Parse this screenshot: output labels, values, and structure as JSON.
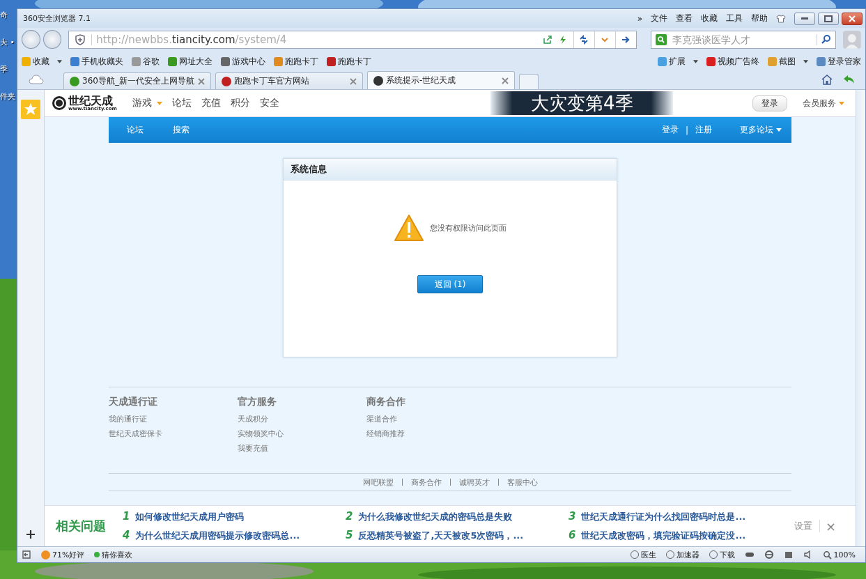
{
  "desktop": {
    "labels": [
      "奇",
      "夫 •",
      "季",
      "件夹"
    ]
  },
  "window": {
    "title": "360安全浏览器 7.1",
    "menu": [
      "»",
      "文件",
      "查看",
      "收藏",
      "工具",
      "帮助"
    ]
  },
  "address_bar": {
    "url_prefix": "http://newbbs.",
    "url_domain": "tiancity.com",
    "url_path": "/system/4"
  },
  "search": {
    "placeholder": "李克强谈医学人才"
  },
  "bookmarks": [
    {
      "label": "收藏",
      "dropdown": true
    },
    {
      "label": "手机收藏夹",
      "dropdown": false
    },
    {
      "label": "谷歌",
      "dropdown": false
    },
    {
      "label": "网址大全",
      "dropdown": false
    },
    {
      "label": "游戏中心",
      "dropdown": false
    },
    {
      "label": "跑跑卡丁",
      "dropdown": false
    },
    {
      "label": "跑跑卡丁",
      "dropdown": false
    }
  ],
  "extensions": [
    {
      "label": "扩展",
      "dropdown": true
    },
    {
      "label": "视频广告终",
      "dropdown": false
    },
    {
      "label": "截图",
      "dropdown": true
    },
    {
      "label": "登录管家",
      "dropdown": false
    }
  ],
  "tabs": [
    {
      "label": "360导航_新一代安全上网导航",
      "selected": false
    },
    {
      "label": "跑跑卡丁车官方网站",
      "selected": false
    },
    {
      "label": "系统提示-世纪天成",
      "selected": true
    }
  ],
  "site": {
    "logo": "世纪天成",
    "logo_url": "www.tiancity.com",
    "banner": "大灾变第4季",
    "login": "登录",
    "member": "会员服务",
    "nav": [
      {
        "label": "游戏",
        "dropdown": true
      },
      {
        "label": "论坛",
        "dropdown": false
      },
      {
        "label": "充值",
        "dropdown": false
      },
      {
        "label": "积分",
        "dropdown": false
      },
      {
        "label": "安全",
        "dropdown": false
      }
    ]
  },
  "forum_bar": {
    "left": [
      "论坛",
      "搜索"
    ],
    "login": "登录",
    "separator": "|",
    "register": "注册",
    "more": "更多论坛"
  },
  "message": {
    "title": "系统信息",
    "text": "您没有权限访问此页面",
    "button": "返回 (1)"
  },
  "footer": {
    "columns": [
      {
        "heading": "天成通行证",
        "links": [
          "我的通行证",
          "世纪天成密保卡"
        ]
      },
      {
        "heading": "官方服务",
        "links": [
          "天成积分",
          "实物领奖中心",
          "我要充值"
        ]
      },
      {
        "heading": "商务合作",
        "links": [
          "渠道合作",
          "经销商推荐"
        ]
      }
    ],
    "links": [
      "网吧联盟",
      "商务合作",
      "诚聘英才",
      "客服中心"
    ]
  },
  "related": {
    "title": "相关问题",
    "settings": "设置",
    "close": "×",
    "items": [
      {
        "number": "1",
        "text": "如何修改世纪天成用户密码"
      },
      {
        "number": "2",
        "text": "为什么我修改世纪天成的密码总是失败"
      },
      {
        "number": "3",
        "text": "世纪天成通行证为什么找回密码时总是..."
      },
      {
        "number": "4",
        "text": "为什么世纪天成用密码提示修改密码总..."
      },
      {
        "number": "5",
        "text": "反恐精英号被盗了,天天被改5次密码，..."
      },
      {
        "number": "6",
        "text": "世纪天成改密码，填完验证码按确定没..."
      }
    ]
  },
  "status_bar": {
    "rating": "71%好评",
    "guess": "猜你喜欢",
    "tools": [
      "医生",
      "加速器",
      "下载"
    ],
    "zoom": "100%"
  }
}
